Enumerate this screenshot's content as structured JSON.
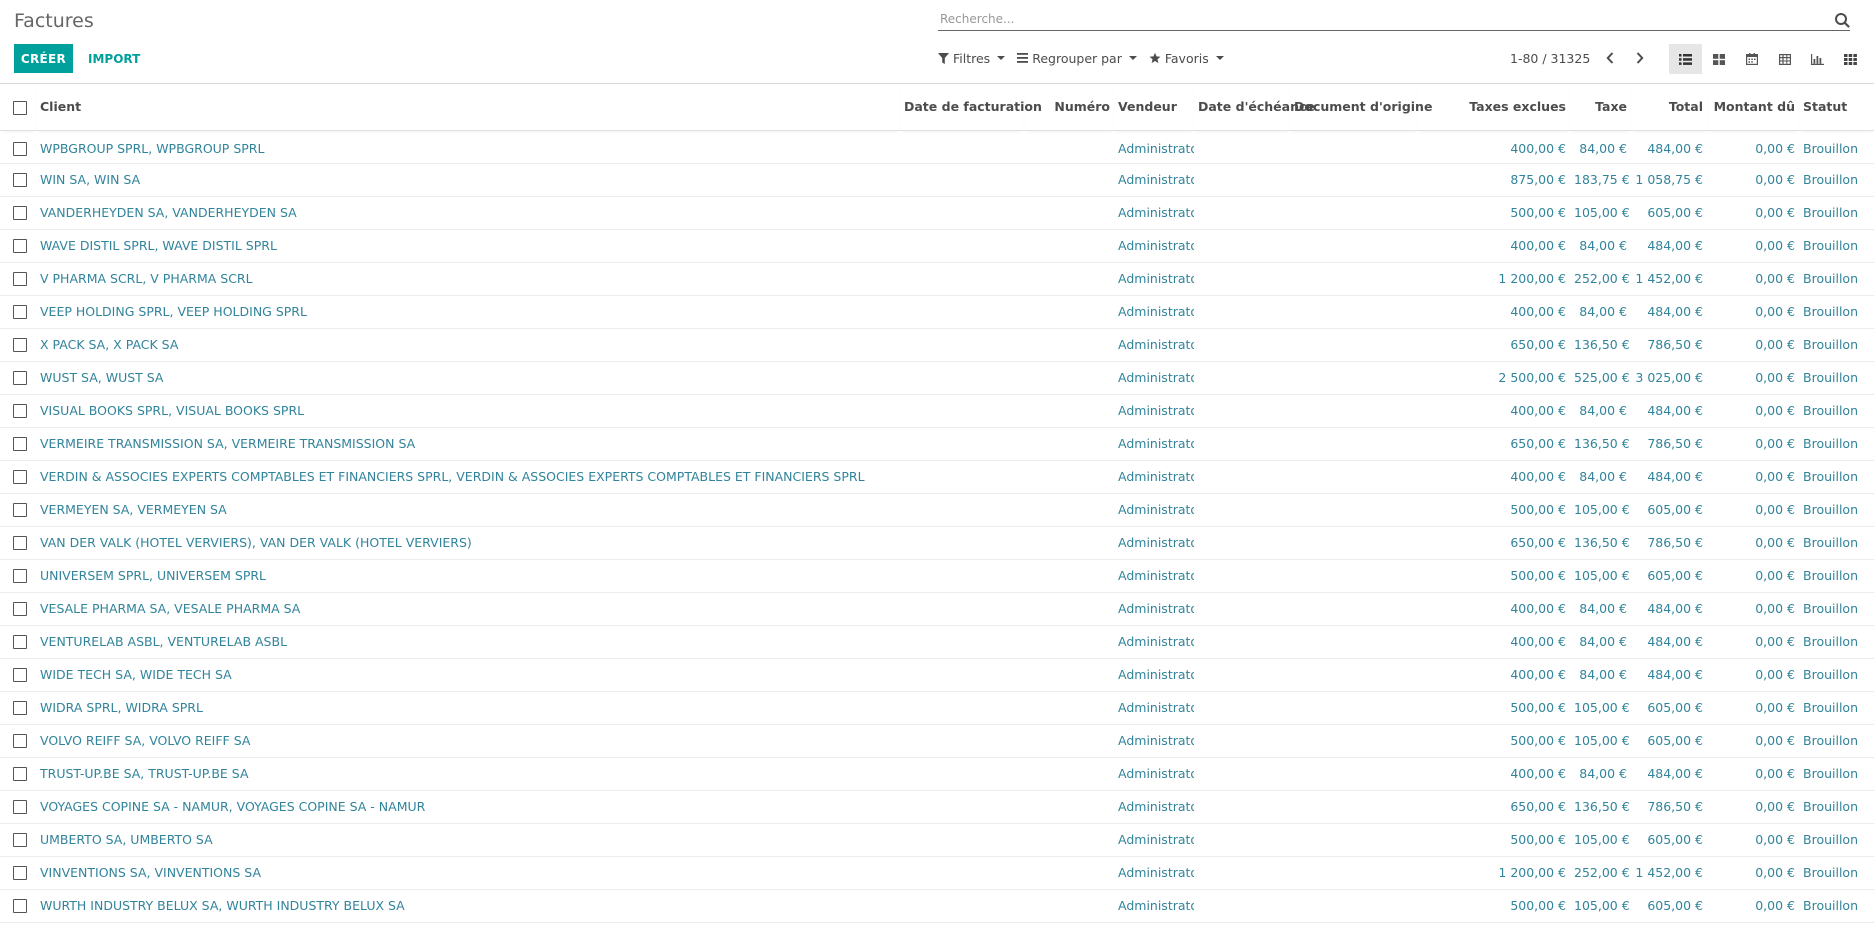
{
  "header": {
    "title": "Factures",
    "search_placeholder": "Recherche...",
    "create_label": "CRÉER",
    "import_label": "IMPORT",
    "filters_label": "Filtres",
    "groupby_label": "Regrouper par",
    "favorites_label": "Favoris",
    "pager": "1-80 / 31325"
  },
  "view_icons": [
    "list-view-icon",
    "kanban-view-icon",
    "calendar-view-icon",
    "pivot-view-icon",
    "graph-view-icon",
    "grid-view-icon"
  ],
  "colors": {
    "accent": "#00a09d",
    "link": "#31849b",
    "text": "#4c4c4c"
  },
  "table": {
    "columns": [
      "Client",
      "Date de facturation",
      "Numéro",
      "Vendeur",
      "Date d'échéance",
      "Document d'origine",
      "Taxes exclues",
      "Taxe",
      "Total",
      "Montant dû",
      "Statut"
    ],
    "rows": [
      [
        "WPBGROUP SPRL, WPBGROUP SPRL",
        "",
        "",
        "Administrator",
        "",
        "",
        "400,00 €",
        "84,00 €",
        "484,00 €",
        "0,00 €",
        "Brouillon"
      ],
      [
        "WIN SA, WIN SA",
        "",
        "",
        "Administrator",
        "",
        "",
        "875,00 €",
        "183,75 €",
        "1 058,75 €",
        "0,00 €",
        "Brouillon"
      ],
      [
        "VANDERHEYDEN SA, VANDERHEYDEN SA",
        "",
        "",
        "Administrator",
        "",
        "",
        "500,00 €",
        "105,00 €",
        "605,00 €",
        "0,00 €",
        "Brouillon"
      ],
      [
        "WAVE DISTIL SPRL, WAVE DISTIL SPRL",
        "",
        "",
        "Administrator",
        "",
        "",
        "400,00 €",
        "84,00 €",
        "484,00 €",
        "0,00 €",
        "Brouillon"
      ],
      [
        "V PHARMA SCRL, V PHARMA SCRL",
        "",
        "",
        "Administrator",
        "",
        "",
        "1 200,00 €",
        "252,00 €",
        "1 452,00 €",
        "0,00 €",
        "Brouillon"
      ],
      [
        "VEEP HOLDING SPRL, VEEP HOLDING SPRL",
        "",
        "",
        "Administrator",
        "",
        "",
        "400,00 €",
        "84,00 €",
        "484,00 €",
        "0,00 €",
        "Brouillon"
      ],
      [
        "X PACK SA, X PACK SA",
        "",
        "",
        "Administrator",
        "",
        "",
        "650,00 €",
        "136,50 €",
        "786,50 €",
        "0,00 €",
        "Brouillon"
      ],
      [
        "WUST SA, WUST SA",
        "",
        "",
        "Administrator",
        "",
        "",
        "2 500,00 €",
        "525,00 €",
        "3 025,00 €",
        "0,00 €",
        "Brouillon"
      ],
      [
        "VISUAL BOOKS SPRL, VISUAL BOOKS SPRL",
        "",
        "",
        "Administrator",
        "",
        "",
        "400,00 €",
        "84,00 €",
        "484,00 €",
        "0,00 €",
        "Brouillon"
      ],
      [
        "VERMEIRE TRANSMISSION SA, VERMEIRE TRANSMISSION SA",
        "",
        "",
        "Administrator",
        "",
        "",
        "650,00 €",
        "136,50 €",
        "786,50 €",
        "0,00 €",
        "Brouillon"
      ],
      [
        "VERDIN & ASSOCIES EXPERTS COMPTABLES ET FINANCIERS SPRL, VERDIN & ASSOCIES EXPERTS COMPTABLES ET FINANCIERS SPRL",
        "",
        "",
        "Administrator",
        "",
        "",
        "400,00 €",
        "84,00 €",
        "484,00 €",
        "0,00 €",
        "Brouillon"
      ],
      [
        "VERMEYEN SA, VERMEYEN SA",
        "",
        "",
        "Administrator",
        "",
        "",
        "500,00 €",
        "105,00 €",
        "605,00 €",
        "0,00 €",
        "Brouillon"
      ],
      [
        "VAN DER VALK (HOTEL VERVIERS), VAN DER VALK (HOTEL VERVIERS)",
        "",
        "",
        "Administrator",
        "",
        "",
        "650,00 €",
        "136,50 €",
        "786,50 €",
        "0,00 €",
        "Brouillon"
      ],
      [
        "UNIVERSEM SPRL, UNIVERSEM SPRL",
        "",
        "",
        "Administrator",
        "",
        "",
        "500,00 €",
        "105,00 €",
        "605,00 €",
        "0,00 €",
        "Brouillon"
      ],
      [
        "VESALE PHARMA SA, VESALE PHARMA SA",
        "",
        "",
        "Administrator",
        "",
        "",
        "400,00 €",
        "84,00 €",
        "484,00 €",
        "0,00 €",
        "Brouillon"
      ],
      [
        "VENTURELAB ASBL, VENTURELAB ASBL",
        "",
        "",
        "Administrator",
        "",
        "",
        "400,00 €",
        "84,00 €",
        "484,00 €",
        "0,00 €",
        "Brouillon"
      ],
      [
        "WIDE TECH SA, WIDE TECH SA",
        "",
        "",
        "Administrator",
        "",
        "",
        "400,00 €",
        "84,00 €",
        "484,00 €",
        "0,00 €",
        "Brouillon"
      ],
      [
        "WIDRA SPRL, WIDRA SPRL",
        "",
        "",
        "Administrator",
        "",
        "",
        "500,00 €",
        "105,00 €",
        "605,00 €",
        "0,00 €",
        "Brouillon"
      ],
      [
        "VOLVO REIFF SA, VOLVO REIFF SA",
        "",
        "",
        "Administrator",
        "",
        "",
        "500,00 €",
        "105,00 €",
        "605,00 €",
        "0,00 €",
        "Brouillon"
      ],
      [
        "TRUST-UP.BE SA, TRUST-UP.BE SA",
        "",
        "",
        "Administrator",
        "",
        "",
        "400,00 €",
        "84,00 €",
        "484,00 €",
        "0,00 €",
        "Brouillon"
      ],
      [
        "VOYAGES COPINE SA - NAMUR, VOYAGES COPINE SA - NAMUR",
        "",
        "",
        "Administrator",
        "",
        "",
        "650,00 €",
        "136,50 €",
        "786,50 €",
        "0,00 €",
        "Brouillon"
      ],
      [
        "UMBERTO SA, UMBERTO SA",
        "",
        "",
        "Administrator",
        "",
        "",
        "500,00 €",
        "105,00 €",
        "605,00 €",
        "0,00 €",
        "Brouillon"
      ],
      [
        "VINVENTIONS SA, VINVENTIONS SA",
        "",
        "",
        "Administrator",
        "",
        "",
        "1 200,00 €",
        "252,00 €",
        "1 452,00 €",
        "0,00 €",
        "Brouillon"
      ],
      [
        "WURTH INDUSTRY BELUX SA, WURTH INDUSTRY BELUX SA",
        "",
        "",
        "Administrator",
        "",
        "",
        "500,00 €",
        "105,00 €",
        "605,00 €",
        "0,00 €",
        "Brouillon"
      ]
    ]
  }
}
